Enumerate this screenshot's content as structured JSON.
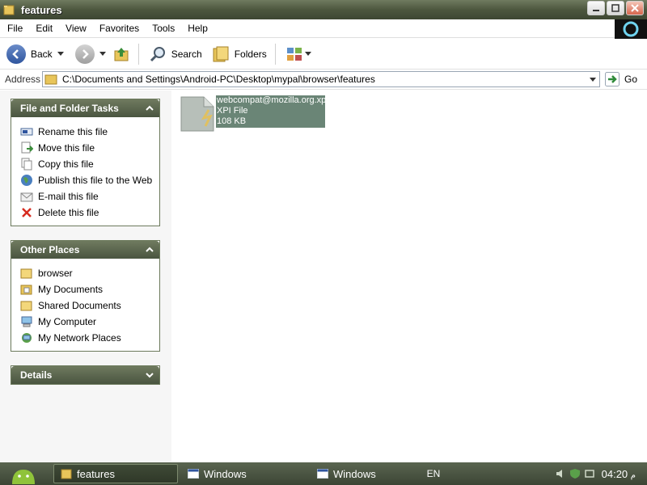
{
  "window": {
    "title": "features"
  },
  "menu": [
    "File",
    "Edit",
    "View",
    "Favorites",
    "Tools",
    "Help"
  ],
  "toolbar": {
    "back_label": "Back",
    "search_label": "Search",
    "folders_label": "Folders"
  },
  "address": {
    "label": "Address",
    "path": "C:\\Documents and Settings\\Android-PC\\Desktop\\mypal\\browser\\features",
    "go_label": "Go"
  },
  "file_tasks": {
    "title": "File and Folder Tasks",
    "items": [
      {
        "label": "Rename this file",
        "icon": "rename-icon"
      },
      {
        "label": "Move this file",
        "icon": "move-icon"
      },
      {
        "label": "Copy this file",
        "icon": "copy-icon"
      },
      {
        "label": "Publish this file to the Web",
        "icon": "globe-icon"
      },
      {
        "label": "E-mail this file",
        "icon": "email-icon"
      },
      {
        "label": "Delete this file",
        "icon": "delete-icon"
      }
    ]
  },
  "other_places": {
    "title": "Other Places",
    "items": [
      {
        "label": "browser",
        "icon": "folder-icon"
      },
      {
        "label": "My Documents",
        "icon": "my-documents-icon"
      },
      {
        "label": "Shared Documents",
        "icon": "folder-icon"
      },
      {
        "label": "My Computer",
        "icon": "computer-icon"
      },
      {
        "label": "My Network Places",
        "icon": "network-icon"
      }
    ]
  },
  "details": {
    "title": "Details"
  },
  "file": {
    "name": "webcompat@mozilla.org.xpi",
    "type": "XPI File",
    "size": "108 KB"
  },
  "taskbar": {
    "items": [
      {
        "label": "features",
        "active": true
      },
      {
        "label": "Windows",
        "active": false
      },
      {
        "label": "Windows",
        "active": false
      }
    ],
    "lang": "EN",
    "clock": "04:20",
    "ampm": "م"
  },
  "colors": {
    "accent": "#4d573f",
    "selection": "#6a8576"
  }
}
